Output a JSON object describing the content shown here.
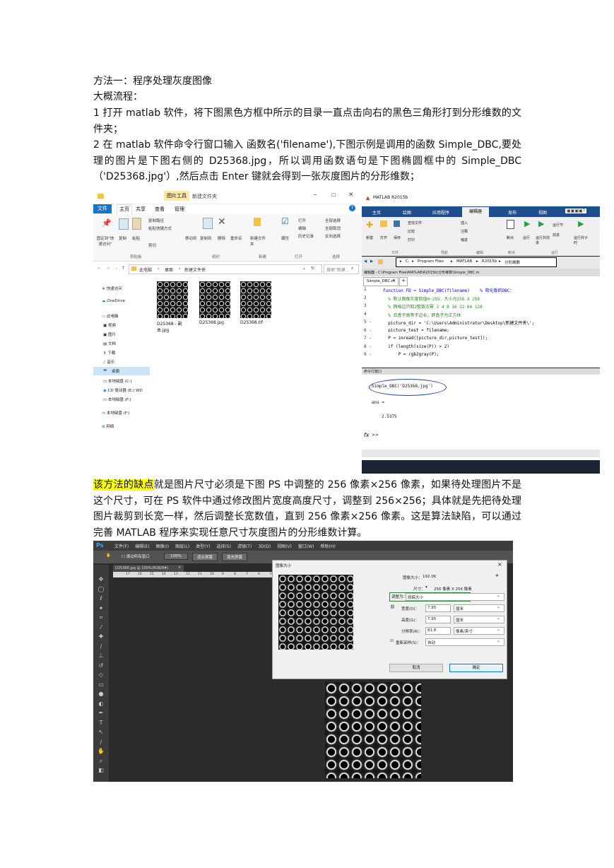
{
  "doc": {
    "heading": "方法一：程序处理灰度图像",
    "flow_label": "大概流程：",
    "step1": "1 打开 matlab 软件，将下图黑色方框中所示的目录一直点击向右的黑色三角形打到分形维数的文件夹；",
    "step2": "2 在 matlab 软件命令行窗口输入    函数名('filename'),下图示例是调用的函数 Simple_DBC,要处理的图片是下图右侧的 D25368.jpg，所以调用函数语句是下图椭圆框中的 Simple_DBC（'D25368.jpg'）,然后点击 Enter 键就会得到一张灰度图片的分形维数；",
    "drawback_highlight": "该方法的缺点",
    "drawback_text": "就是图片尺寸必须是下图 PS 中调整的 256 像素×256 像素，如果待处理图片不是这个尺寸，可在 PS 软件中通过修改图片宽度高度尺寸，调整到 256×256；具体就是先把待处理图片裁剪到长宽一样，然后调整长宽数值，直到 256 像素×256 像素。这是算法缺陷，可以通过完善 MATLAB 程序来实现任意尺寸灰度图片的分形维数计算。"
  },
  "explorer": {
    "title": "新建文件夹",
    "picture_tools": "图片工具",
    "ribbon_tabs": [
      "文件",
      "主页",
      "共享",
      "查看",
      "管理"
    ],
    "ribbon_buttons": [
      "固定到\"快速访问\"",
      "复制",
      "粘贴",
      "复制路径",
      "粘贴快捷方式",
      "剪切",
      "移动到",
      "复制到",
      "删除",
      "重命名",
      "新建文件夹",
      "属性",
      "打开",
      "编辑",
      "历史记录",
      "全部选择",
      "全部取消",
      "反向选择"
    ],
    "ribbon_groups": [
      "剪贴板",
      "组织",
      "新建",
      "打开",
      "选择"
    ],
    "path": [
      "此电脑",
      "桌面",
      "新建文件夹"
    ],
    "search_placeholder": "搜索\"新建...",
    "nav": [
      "快速访问",
      "OneDrive",
      "此电脑",
      "视频",
      "图片",
      "文档",
      "下载",
      "音乐",
      "桌面",
      "本地磁盘 (C:)",
      "CD 驱动器 (E:) WD",
      "本地磁盘 (F:)",
      "本地磁盘 (F:)",
      "网络"
    ],
    "files": [
      "D25368 - 副本.jpg",
      "D25368.jpg",
      "D25368.tif"
    ]
  },
  "matlab": {
    "title": "MATLAB R2015b",
    "tabs": [
      "主页",
      "绘图",
      "应用程序",
      "编辑器",
      "发布",
      "视图"
    ],
    "toolstrip_buttons": [
      "新建",
      "打开",
      "保存",
      "查找文件",
      "比较",
      "打印",
      "插入",
      "注释",
      "缩进",
      "断点",
      "运行",
      "运行并前进",
      "运行节",
      "前进",
      "运行并计时"
    ],
    "toolstrip_groups": [
      "文件",
      "导航",
      "编辑",
      "断点",
      "运行"
    ],
    "path": [
      "C:",
      "Program Files",
      "MATLAB",
      "R2015b",
      "分形维数"
    ],
    "editor_title": "编辑器 - C:\\Program Files\\MATLAB\\R2015b\\分形维数\\Simple_DBC.m",
    "editor_tab": "Simple_DBC.m",
    "code_lines": [
      {
        "n": "1",
        "t": "function FD = Simple_DBC(filename)    % 简化版的DBC："
      },
      {
        "n": "2",
        "t": "  % 默认图像灰度取值0~255，大小为256 X 256"
      },
      {
        "n": "3",
        "t": "  % 网格边只取2整数次幂 2 4 8 16 32 64 128"
      },
      {
        "n": "4",
        "t": "  % 且盒子高等于边长，即盒子为正方体"
      },
      {
        "n": "5 -",
        "t": "  picture_dir = 'C:\\Users\\Administrator\\Desktop\\新建文件夹\\';"
      },
      {
        "n": "6 -",
        "t": "  picture_test = filename;"
      },
      {
        "n": "7 -",
        "t": "  P = imread([picture_dir,picture_test]);"
      },
      {
        "n": "8 -",
        "t": "  if (length(size(P)) > 2)"
      },
      {
        "n": "9 -",
        "t": "      P = rgb2gray(P);"
      }
    ],
    "cmd_title": "命令行窗口",
    "cmd_input": "Simple_DBC('D25368.jpg')",
    "cmd_ans": "ans =",
    "cmd_value": "2.5375",
    "prompt": ">>"
  },
  "ps": {
    "logo": "Ps",
    "menu": [
      "文件(F)",
      "编辑(E)",
      "图像(I)",
      "图层(L)",
      "类型(Y)",
      "选择(S)",
      "滤镜(T)",
      "3D(D)",
      "视图(V)",
      "窗口(W)",
      "帮助(H)"
    ],
    "options": [
      "滚动所有窗口",
      "100%",
      "适合屏幕",
      "填充屏幕"
    ],
    "doc_tab": "D25368.jpg @ 100%(RGB/8#)",
    "ruler_ticks": [
      "17",
      "16",
      "15",
      "14",
      "13",
      "12",
      "11",
      "10",
      "9",
      "8",
      "7",
      "6",
      "5"
    ],
    "dialog": {
      "title": "图像大小",
      "image_size_label": "图像大小：",
      "image_size_value": "192.0K",
      "dimensions_label": "尺寸：",
      "dimensions_value": "256 像素 X 256 像素",
      "fit_label": "调整为：",
      "fit_value": "原稿大小",
      "width_label": "宽度(D)：",
      "width_value": "7.95",
      "width_unit": "厘米",
      "height_label": "高度(G)：",
      "height_value": "7.95",
      "height_unit": "厘米",
      "res_label": "分辨率(R)：",
      "res_value": "81.8",
      "res_unit": "像素/英寸",
      "resample_label": "重新采样(S)：",
      "resample_value": "自动",
      "cancel": "取消",
      "ok": "确定"
    }
  },
  "colors": {
    "highlight": "#ffff00",
    "matlab_blue": "#1e4e8c",
    "ps_dark": "#2b2b2b",
    "ps_blue": "#31a8ff",
    "explorer_accent": "#1a73c8"
  }
}
